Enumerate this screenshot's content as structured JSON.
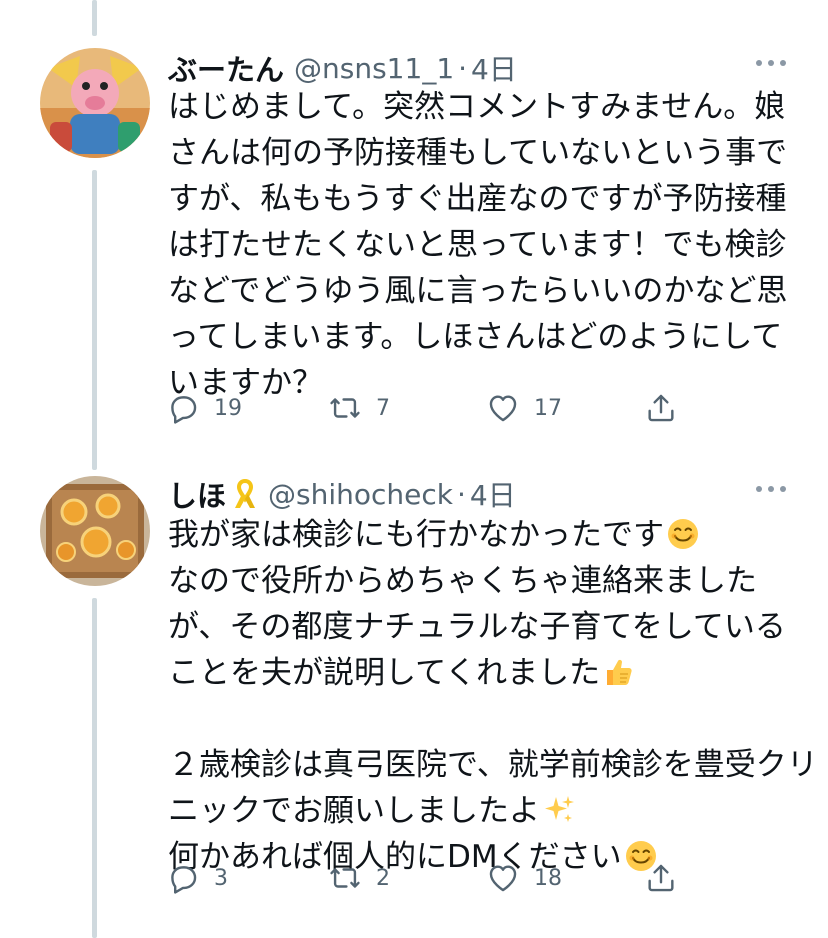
{
  "tweets": [
    {
      "name": "ぶーたん",
      "handle": "@nsns11_1",
      "separator": "·",
      "time": "4日",
      "avatar_icon": "cartoon-character-avatar",
      "lines": [
        "はじめまして。突然コメントすみません。娘",
        "さんは何の予防接種もしていないという事で",
        "すが、私ももうすぐ出産なのですが予防接種",
        "は打たせたくないと思っています！でも検診",
        "などでどうゆう風に言ったらいいのかなど思",
        "ってしまいます。しほさんはどのようにして",
        "いますか？"
      ],
      "reply_count": "19",
      "retweet_count": "7",
      "like_count": "17"
    },
    {
      "name": "しほ",
      "name_badge_icon": "yellow-ribbon-icon",
      "handle": "@shihocheck",
      "separator": "·",
      "time": "4日",
      "avatar_icon": "orange-cake-avatar",
      "lines": [
        "我が家は検診にも行かなかったです",
        "なので役所からめちゃくちゃ連絡来ました",
        "が、その都度ナチュラルな子育てをしている",
        "ことを夫が説明してくれました",
        "",
        "２歳検診は真弓医院で、就学前検診を豊受クリ",
        "ニックでお願いしましたよ",
        "何かあれば個人的にDMください"
      ],
      "reply_count": "3",
      "retweet_count": "2",
      "like_count": "18"
    }
  ],
  "colors": {
    "text": "#0f1419",
    "secondary": "#536471",
    "thread_line": "#cfd9de",
    "icon": "#536471"
  }
}
